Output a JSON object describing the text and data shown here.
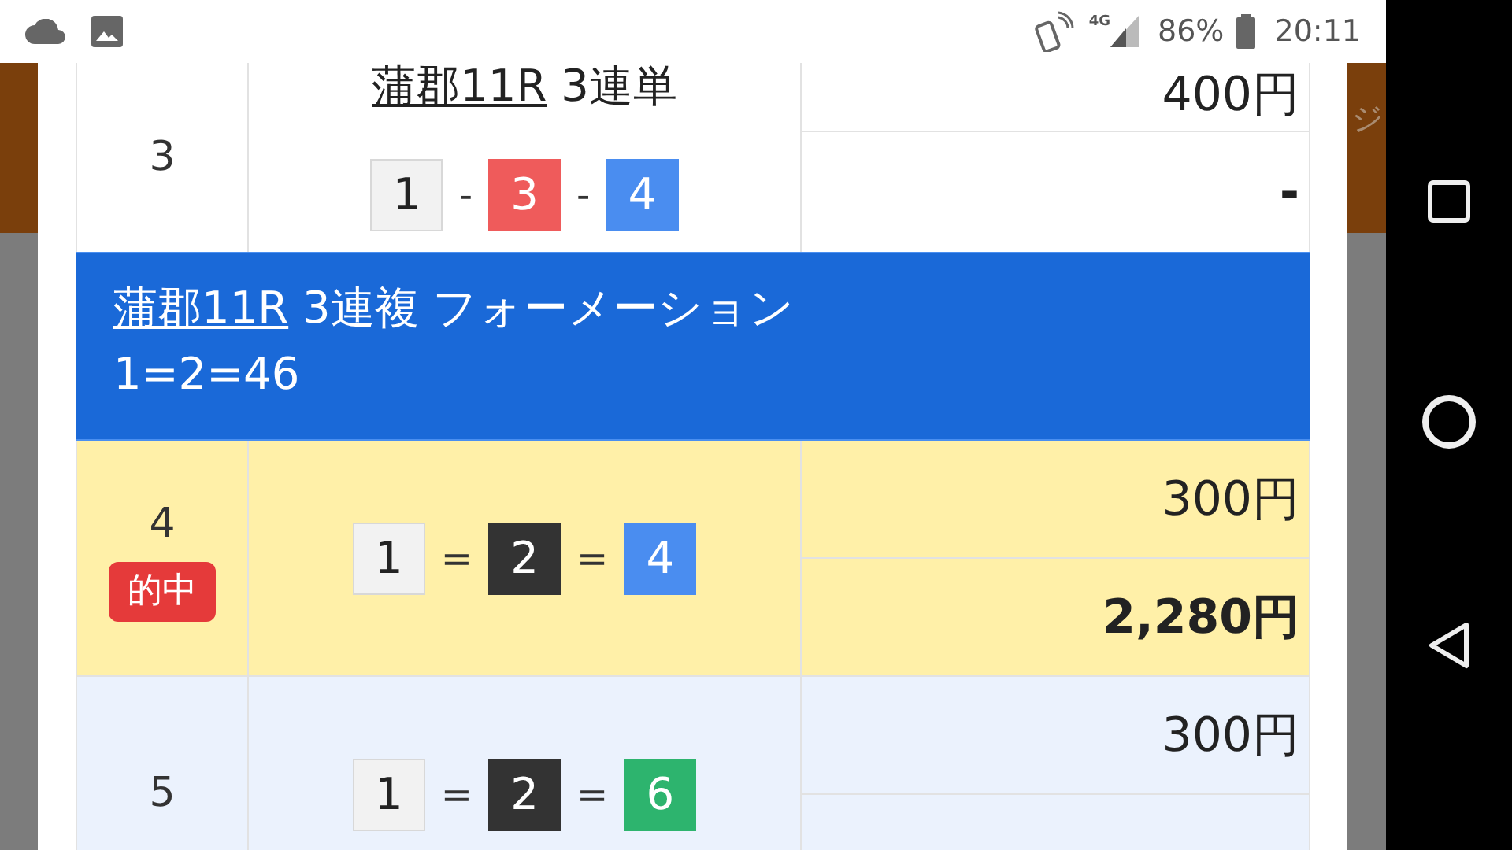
{
  "status_bar": {
    "network": "4G",
    "battery": "86%",
    "time": "20:11"
  },
  "background_page": {
    "text": "ジ"
  },
  "rows": [
    {
      "kind": "bet",
      "number": "3",
      "hit": false,
      "race": "蒲郡11R",
      "bet_type": " 3連単",
      "separator": "-",
      "combo": [
        {
          "num": "1",
          "color": "#f2f2f2"
        },
        {
          "num": "3",
          "color": "#ef5b5b"
        },
        {
          "num": "4",
          "color": "#4a8df0"
        }
      ],
      "amounts": [
        "400円",
        "-"
      ]
    },
    {
      "kind": "header",
      "race": "蒲郡11R",
      "title": " 3連複 フォーメーション",
      "combination": "1=2=46"
    },
    {
      "kind": "bet",
      "number": "4",
      "hit": true,
      "badge": "的中",
      "separator": "=",
      "combo": [
        {
          "num": "1",
          "color": "#f2f2f2"
        },
        {
          "num": "2",
          "color": "#333333"
        },
        {
          "num": "4",
          "color": "#4a8df0"
        }
      ],
      "amounts": [
        "300円",
        "2,280円"
      ]
    },
    {
      "kind": "bet",
      "number": "5",
      "hit": false,
      "separator": "=",
      "combo": [
        {
          "num": "1",
          "color": "#f2f2f2"
        },
        {
          "num": "2",
          "color": "#333333"
        },
        {
          "num": "6",
          "color": "#2db46e"
        }
      ],
      "amounts": [
        "300円"
      ]
    }
  ]
}
